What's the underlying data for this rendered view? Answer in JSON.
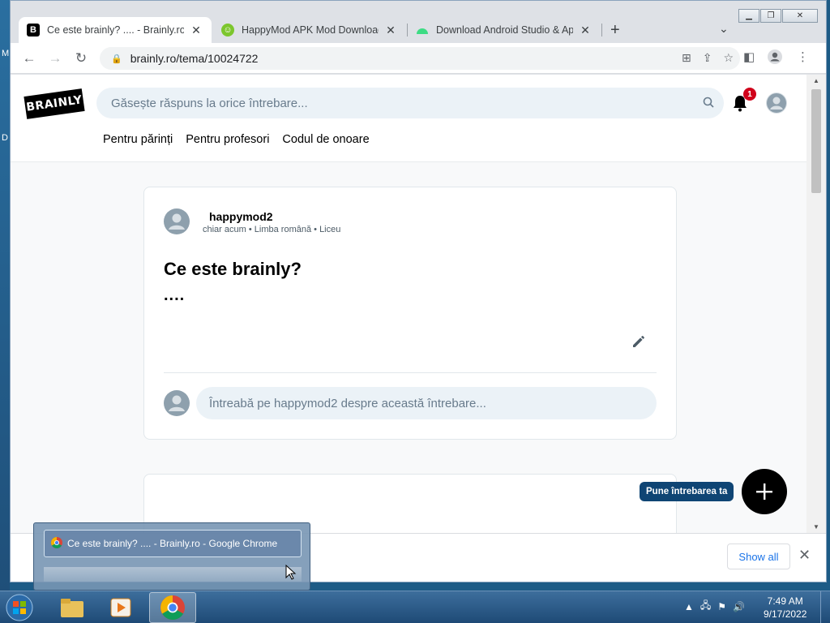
{
  "desktop": {
    "edge_labels": [
      "M",
      "D"
    ]
  },
  "browser": {
    "tabs": [
      {
        "title": "Ce este brainly? .... - Brainly.ro",
        "active": true,
        "icon": "brainly-favicon"
      },
      {
        "title": "HappyMod APK Mod Download",
        "active": false,
        "icon": "happymod-favicon"
      },
      {
        "title": "Download Android Studio & App",
        "active": false,
        "icon": "android-favicon"
      }
    ],
    "url": "brainly.ro/tema/10024722"
  },
  "site": {
    "logo": "BRAINLY",
    "search_placeholder": "Găsește răspuns la orice întrebare...",
    "notification_count": "1",
    "nav_links": [
      "Pentru părinți",
      "Pentru profesori",
      "Codul de onoare"
    ]
  },
  "question": {
    "author": "happymod2",
    "time": "chiar acum",
    "language": "Limba română",
    "level": "Liceu",
    "title": "Ce este brainly?",
    "body": "....",
    "ask_placeholder": "Întreabă pe happymod2 despre această întrebare..."
  },
  "fab": {
    "label": "Pune întrebarea ta"
  },
  "download_bar": {
    "show_all": "Show all"
  },
  "taskbar_preview": {
    "title": "Ce este brainly? .... - Brainly.ro - Google Chrome"
  },
  "clock": {
    "time": "7:49 AM",
    "date": "9/17/2022"
  },
  "colors": {
    "brand_dark": "#0f4574",
    "badge": "#d0021b",
    "search_bg": "#ebf2f7"
  }
}
